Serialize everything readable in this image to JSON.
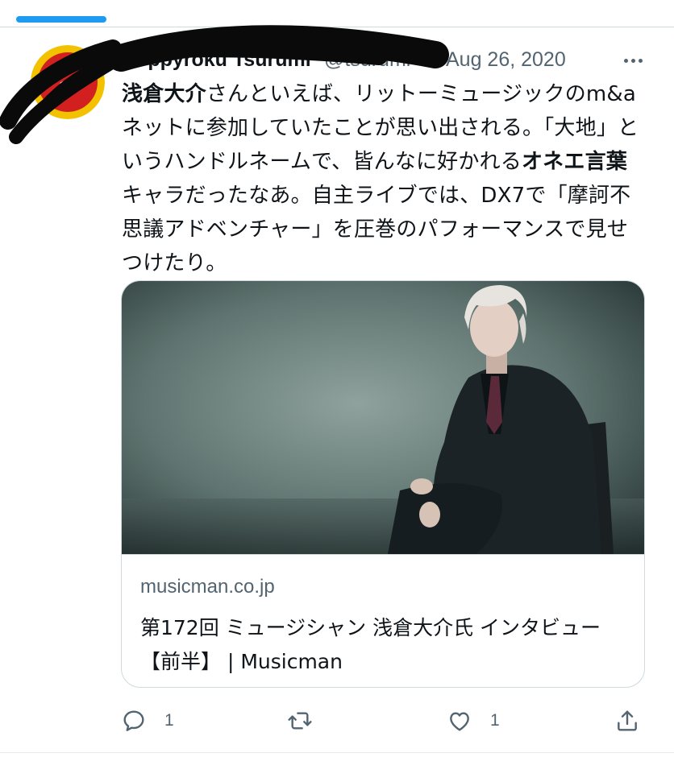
{
  "tweet": {
    "author_name": "Koppyroku Tsurumi",
    "author_handle": "@tsurumi",
    "date": "Aug 26, 2020",
    "text_runs": [
      {
        "text": "浅倉大介",
        "bold": true
      },
      {
        "text": "さんといえば、リットーミュージックのm&aネットに参加していたことが思い出される。「大地」というハンドルネームで、皆んなに好かれる",
        "bold": false
      },
      {
        "text": "オネエ言葉",
        "bold": true
      },
      {
        "text": "キャラだったなあ。自主ライブでは、DX7で「摩訶不思議アドベンチャー」を圧巻のパフォーマンスで見せつけたり。",
        "bold": false
      }
    ]
  },
  "card": {
    "domain": "musicman.co.jp",
    "title": "第172回 ミュージシャン 浅倉大介氏 インタビュー【前半】 | Musicman"
  },
  "actions": {
    "reply_count": "1",
    "retweet_count": "",
    "like_count": "1"
  },
  "colors": {
    "accent": "#1d9bf0",
    "secondary_text": "#536471",
    "border": "#cfd9de",
    "avatar_ring": "#f2c200",
    "avatar_fill": "#d21f1f"
  }
}
